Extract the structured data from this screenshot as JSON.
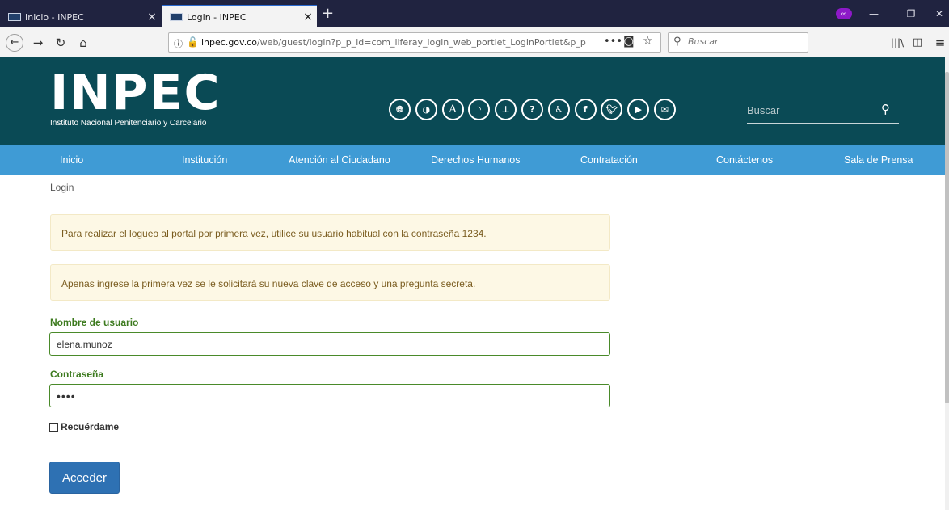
{
  "browser": {
    "tabs": [
      {
        "title": "Inicio - INPEC",
        "favicon": "inpec-favicon",
        "active": false
      },
      {
        "title": "Login - INPEC",
        "favicon": "inpec-favicon",
        "active": true
      }
    ],
    "new_tab_label": "+",
    "close_label": "×",
    "url_host": "inpec.gov.co",
    "url_path": "/web/guest/login?p_p_id=com_liferay_login_web_portlet_LoginPortlet&p_p",
    "search_placeholder": "Buscar",
    "icons": [
      "back-icon",
      "forward-icon",
      "reload-icon",
      "home-icon",
      "info-icon",
      "insecure-lock-icon",
      "page-actions-icon",
      "pocket-icon",
      "bookmark-star-icon",
      "search-icon",
      "library-icon",
      "sidebar-icon",
      "menu-icon",
      "private-browsing-icon"
    ],
    "colors": {
      "tabbar": "#202340",
      "active_tab_accent": "#2a6ad0",
      "private_mask": "#8d19c8"
    }
  },
  "site": {
    "logo_text": "INPEC",
    "logo_subtitle": "Instituto Nacional Penitenciario y Carcelario",
    "accessibility_icons": [
      "globe-icon",
      "contrast-icon",
      "font-size-icon",
      "rss-icon",
      "sitemap-icon",
      "help-icon",
      "accessibility-icon",
      "facebook-icon",
      "twitter-icon",
      "youtube-icon",
      "email-icon"
    ],
    "search_placeholder": "Buscar",
    "colors": {
      "header": "#0a4a55",
      "nav": "#3f9bd5",
      "label_green": "#3c7a1e",
      "button": "#2e71b3",
      "alert_bg": "#fdf8e5"
    }
  },
  "nav": {
    "items": [
      "Inicio",
      "Institución",
      "Atención al Ciudadano",
      "Derechos Humanos",
      "Contratación",
      "Contáctenos",
      "Sala de Prensa"
    ]
  },
  "breadcrumb": "Login",
  "alerts": [
    "Para realizar el logueo al portal por primera vez, utilice su usuario habitual con la contraseña 1234.",
    "Apenas ingrese la primera vez se le solicitará su nueva clave de acceso y una pregunta secreta."
  ],
  "form": {
    "username_label": "Nombre de usuario",
    "username_value": "elena.munoz",
    "password_label": "Contraseña",
    "password_mask": "••••",
    "remember_label": "Recuérdame",
    "remember_checked": false,
    "submit_label": "Acceder"
  }
}
